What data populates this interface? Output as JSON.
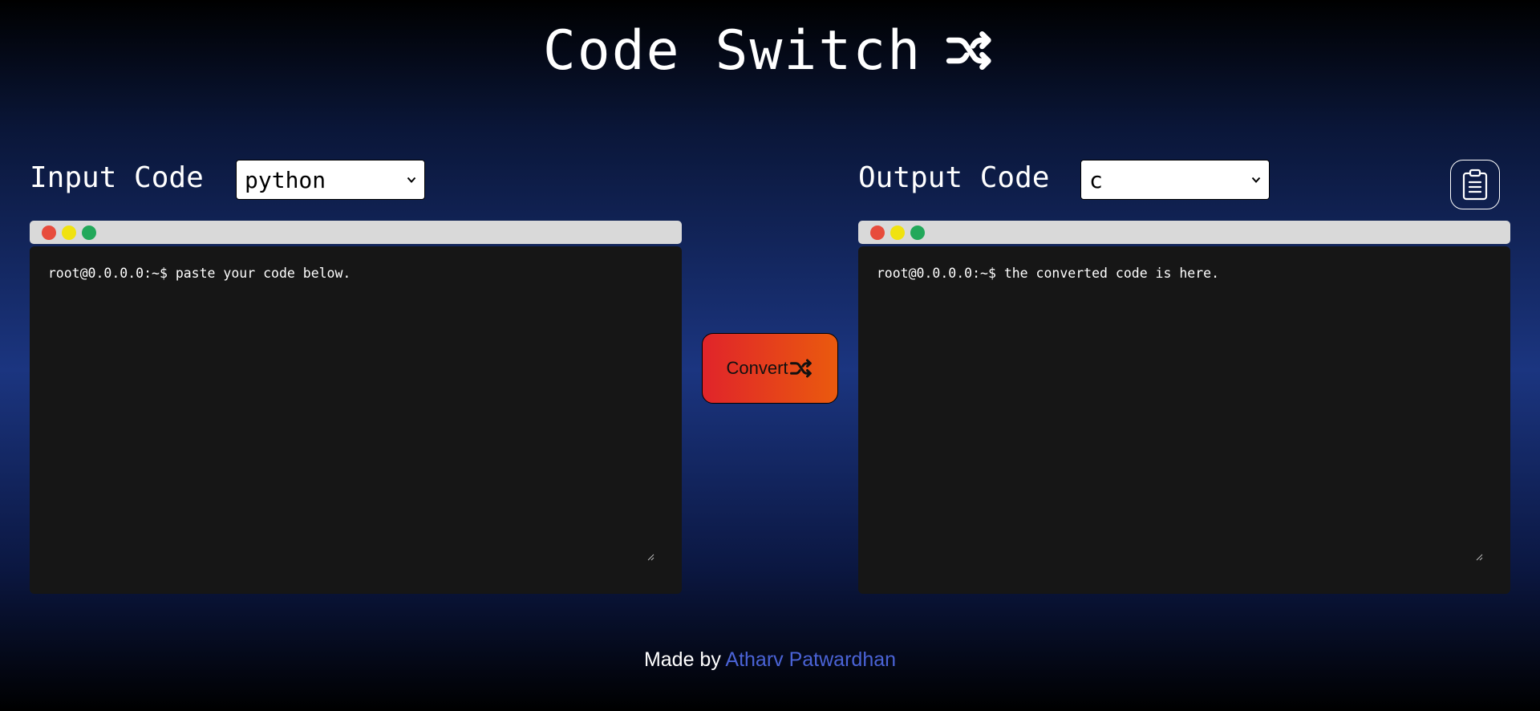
{
  "header": {
    "title": "Code Switch",
    "icon": "shuffle-icon"
  },
  "input_panel": {
    "label": "Input Code",
    "language_selected": "python",
    "terminal_dots": [
      "#e74b3c",
      "#f0e210",
      "#22a85a"
    ],
    "prompt_text": "root@0.0.0.0:~$ paste your code below."
  },
  "output_panel": {
    "label": "Output Code",
    "language_selected": "c",
    "terminal_dots": [
      "#e74b3c",
      "#f0e210",
      "#22a85a"
    ],
    "prompt_text": "root@0.0.0.0:~$ the converted code is here.",
    "copy_icon": "clipboard-icon"
  },
  "convert_button": {
    "label": "Convert",
    "icon": "shuffle-icon"
  },
  "footer": {
    "prefix": "Made by ",
    "author": "Atharv Patwardhan"
  },
  "colors": {
    "accent_link": "#4a63d6",
    "button_gradient_start": "#e0242a",
    "button_gradient_end": "#ea5a0e",
    "terminal_bg": "#161616",
    "terminal_bar": "#d9d9d9"
  }
}
